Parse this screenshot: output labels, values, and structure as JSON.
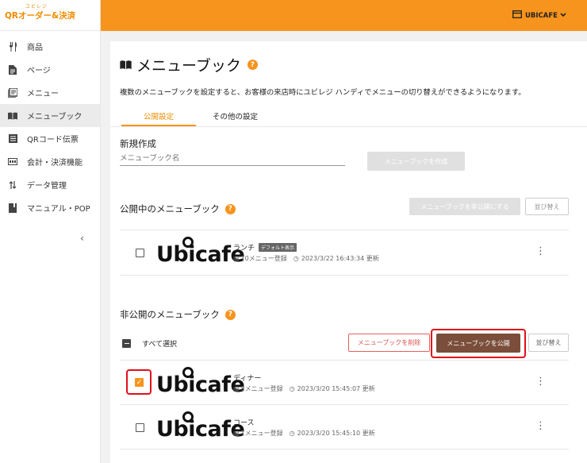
{
  "app": {
    "logo_small": "ユビレジ",
    "logo_main": "QRオーダー&決済"
  },
  "header": {
    "store_name": "UBICAFE",
    "store_icon": "store-icon",
    "chevron_icon": "chevron-down-icon"
  },
  "sidebar": {
    "items": [
      {
        "label": "商品",
        "icon": "fork-knife-icon"
      },
      {
        "label": "ページ",
        "icon": "page-icon"
      },
      {
        "label": "メニュー",
        "icon": "menu-list-icon"
      },
      {
        "label": "メニューブック",
        "icon": "book-icon",
        "active": true
      },
      {
        "label": "QRコード伝票",
        "icon": "receipt-icon"
      },
      {
        "label": "会計・決済機能",
        "icon": "payment-icon"
      },
      {
        "label": "データ管理",
        "icon": "sort-icon"
      },
      {
        "label": "マニュアル・POP",
        "icon": "manual-icon"
      }
    ],
    "collapse_label": "‹"
  },
  "page": {
    "title": "メニューブック",
    "help": "?",
    "description": "複数のメニューブックを設定すると、お客様の来店時にユビレジ ハンディでメニューの切り替えができるようになります。",
    "tabs": [
      "公開設定",
      "その他の設定"
    ],
    "active_tab": 0
  },
  "create": {
    "heading": "新規作成",
    "placeholder": "メニューブック名",
    "button": "メニューブックを作成"
  },
  "published": {
    "heading": "公開中のメニューブック",
    "unpublish_button": "メニューブックを非公開にする",
    "sort_button": "並び替え",
    "items": [
      {
        "logo": "Ubicafe",
        "name": "ランチ",
        "badge": "デフォルト表示",
        "count": "10メニュー登録",
        "updated": "2023/3/22 16:43:34 更新",
        "checked": false
      }
    ]
  },
  "unpublished": {
    "heading": "非公開のメニューブック",
    "select_all": "すべて選択",
    "delete_button": "メニューブックを削除",
    "publish_button": "メニューブックを公開",
    "sort_button": "並び替え",
    "items": [
      {
        "logo": "Ubicafe",
        "name": "ディナー",
        "count": "8メニュー登録",
        "updated": "2023/3/20 15:45:07 更新",
        "checked": true
      },
      {
        "logo": "Ubicafe",
        "name": "コース",
        "count": "1メニュー登録",
        "updated": "2023/3/20 15:45:10 更新",
        "checked": false
      }
    ]
  },
  "colors": {
    "accent": "#f7941d",
    "publish_button": "#7a4e3a",
    "highlight": "#e0101a"
  }
}
